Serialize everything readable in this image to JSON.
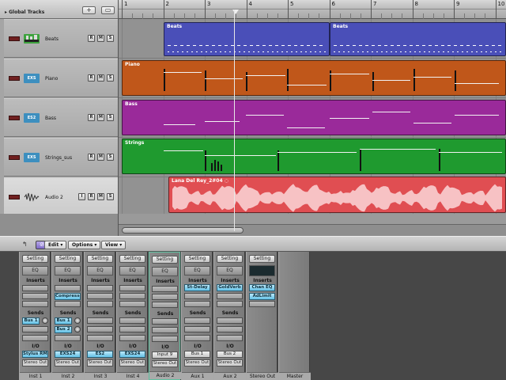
{
  "arrange": {
    "global_tracks_label": "Global Tracks",
    "add_track_label": "+",
    "folder_label": "▭",
    "bar_numbers": [
      "1",
      "2",
      "3",
      "4",
      "5",
      "6",
      "7",
      "8",
      "9",
      "10"
    ],
    "tracks": [
      {
        "name": "Beats",
        "icon": "drum-machine-icon",
        "icon_text": "",
        "icon_color": "#3ea33e"
      },
      {
        "name": "Piano",
        "icon": "exs-sampler-icon",
        "icon_text": "EXS",
        "icon_color": "#3d8fbf"
      },
      {
        "name": "Bass",
        "icon": "es2-synth-icon",
        "icon_text": "ES2",
        "icon_color": "#3d8fbf"
      },
      {
        "name": "Strings_sus",
        "icon": "exs-sampler-icon",
        "icon_text": "EXS",
        "icon_color": "#3d8fbf"
      },
      {
        "name": "Audio 2",
        "icon": "waveform-icon",
        "icon_text": "",
        "icon_color": "#666666"
      }
    ],
    "track_buttons": {
      "input_monitor": "I",
      "record": "R",
      "mute": "M",
      "solo": "S"
    },
    "regions": {
      "beats_1": "Beats",
      "beats_2": "Beats",
      "piano": "Piano",
      "bass": "Bass",
      "strings": "Strings",
      "audio": "Lana Del Rey_2#04 ◌"
    },
    "region_colors": {
      "beats": "#4a4fb8",
      "piano": "#c0571a",
      "bass": "#9a2a9a",
      "strings": "#1f9a2f",
      "audio": "#e04e52"
    }
  },
  "mixer": {
    "toolbar": {
      "edit": "Edit ▾",
      "options": "Options ▾",
      "view": "View ▾",
      "link": "⊘",
      "arrow": "↰"
    },
    "setting_label": "Setting",
    "eq_label": "EQ",
    "inserts_label": "Inserts",
    "sends_label": "Sends",
    "io_label": "I/O",
    "strips": [
      {
        "name": "Inst 1",
        "input": "Stylus RMX",
        "output": "Stereo Out",
        "insert": "",
        "sends": [
          "Bus 1"
        ]
      },
      {
        "name": "Inst 2",
        "input": "EXS24",
        "output": "Stereo Out",
        "insert": "Compresso",
        "sends": [
          "Bus 1",
          "Bus 2"
        ]
      },
      {
        "name": "Inst 3",
        "input": "ES2",
        "output": "Stereo Out",
        "insert": "",
        "sends": []
      },
      {
        "name": "Inst 4",
        "input": "EXS24",
        "output": "Stereo Out",
        "insert": "",
        "sends": []
      },
      {
        "name": "Audio 2",
        "input": "Input 9",
        "output": "Stereo Out",
        "insert": "",
        "sends": []
      },
      {
        "name": "Aux 1",
        "input": "Bus 1",
        "output": "Stereo Out",
        "insert": "St-Delay",
        "sends": []
      },
      {
        "name": "Aux 2",
        "input": "Bus 2",
        "output": "Stereo Out",
        "insert": "GoldVerb",
        "sends": []
      },
      {
        "name": "Stereo Out",
        "input": "",
        "output": "",
        "insert": "Chan EQ",
        "insert2": "AdLimit",
        "sends": []
      },
      {
        "name": "Master",
        "input": "",
        "output": "",
        "insert": "",
        "sends": []
      }
    ]
  }
}
